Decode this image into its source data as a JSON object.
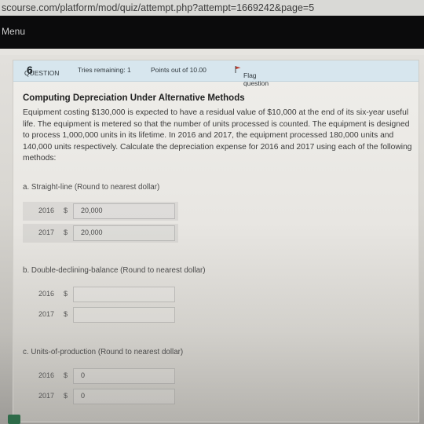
{
  "browser": {
    "url": "scourse.com/platform/mod/quiz/attempt.php?attempt=1669242&page=5"
  },
  "nav": {
    "menu_label": "Menu"
  },
  "question": {
    "label": "QUESTION",
    "number": "6",
    "tries": "Tries remaining: 1",
    "points": "Points out of 10.00",
    "flag": "Flag question",
    "title": "Computing Depreciation Under Alternative Methods",
    "text": "Equipment costing $130,000 is expected to have a residual value of $10,000 at the end of its six-year useful life. The equipment is metered so that the number of units processed is counted. The equipment is designed to process 1,000,000 units in its lifetime. In 2016 and 2017, the equipment processed 180,000 units and 140,000 units respectively. Calculate the depreciation expense for 2016 and 2017 using each of the following methods:"
  },
  "parts": {
    "a": {
      "label": "a. Straight-line (Round to nearest dollar)",
      "rows": [
        {
          "year": "2016",
          "currency": "$",
          "value": "20,000"
        },
        {
          "year": "2017",
          "currency": "$",
          "value": "20,000"
        }
      ]
    },
    "b": {
      "label": "b. Double-declining-balance (Round to nearest dollar)",
      "rows": [
        {
          "year": "2016",
          "currency": "$",
          "value": ""
        },
        {
          "year": "2017",
          "currency": "$",
          "value": ""
        }
      ]
    },
    "c": {
      "label": "c. Units-of-production (Round to nearest dollar)",
      "rows": [
        {
          "year": "2016",
          "currency": "$",
          "value": "0"
        },
        {
          "year": "2017",
          "currency": "$",
          "value": "0"
        }
      ]
    }
  },
  "colors": {
    "header_bg": "#d7e6ee",
    "menubar": "#0b0b0c",
    "flag_red": "#c0392b"
  }
}
